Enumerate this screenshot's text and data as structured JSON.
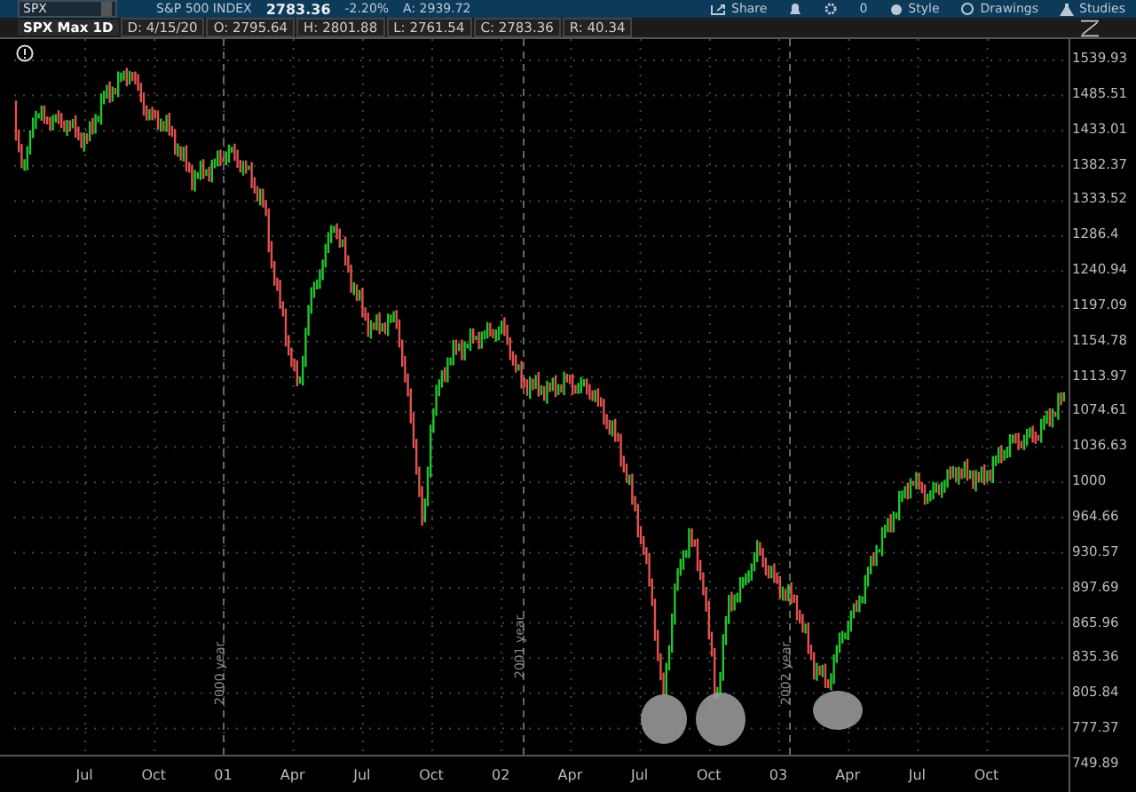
{
  "toolbar": {
    "symbol": "SPX",
    "description": "S&P 500 INDEX",
    "last_price": "2783.36",
    "change": "-2.20%",
    "ask": "A: 2939.72",
    "buttons": [
      {
        "kind": "share",
        "label": "Share"
      },
      {
        "kind": "alert"
      },
      {
        "kind": "settings"
      },
      {
        "kind": "count",
        "label": "0"
      },
      {
        "kind": "style",
        "label": "Style"
      },
      {
        "kind": "drawings",
        "label": "Drawings"
      },
      {
        "kind": "studies",
        "label": "Studies"
      }
    ]
  },
  "chart": {
    "title": "SPX Max 1D",
    "quote": [
      "D: 4/15/20",
      "O: 2795.64",
      "H: 2801.88",
      "L: 2761.54",
      "C: 2783.36",
      "R: 40.34"
    ],
    "price_axis": [
      "1539.93",
      "1485.51",
      "1433.01",
      "1382.37",
      "1333.52",
      "1286.4",
      "1240.94",
      "1197.09",
      "1154.78",
      "1113.97",
      "1074.61",
      "1036.63",
      "1000",
      "964.66",
      "930.57",
      "897.69",
      "865.96",
      "835.36",
      "805.84",
      "777.37",
      "749.89"
    ],
    "time_axis": [
      "Jul",
      "Oct",
      "01",
      "Apr",
      "Jul",
      "Oct",
      "02",
      "Apr",
      "Jul",
      "Oct",
      "03",
      "Apr",
      "Jul",
      "Oct"
    ],
    "year_markers": [
      "2000 year",
      "2001 year",
      "2002 year"
    ]
  }
}
